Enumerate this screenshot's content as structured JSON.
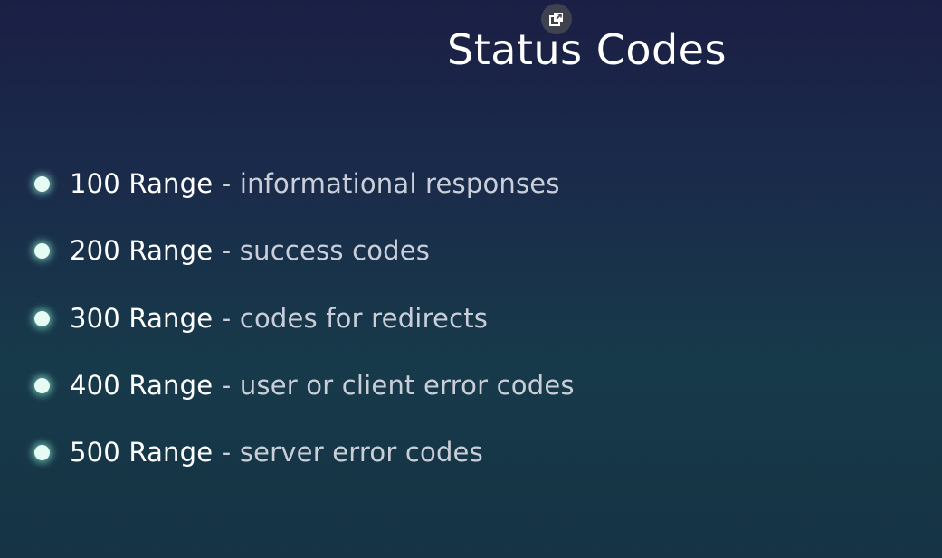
{
  "icons": {
    "popout": "popout-icon"
  },
  "title": "Status Codes",
  "items": [
    {
      "range": "100 Range",
      "separator": " - ",
      "description": "informational responses"
    },
    {
      "range": "200 Range",
      "separator": " - ",
      "description": "success codes"
    },
    {
      "range": "300 Range",
      "separator": " - ",
      "description": "codes for redirects"
    },
    {
      "range": "400 Range",
      "separator": " - ",
      "description": "user or client error codes"
    },
    {
      "range": "500 Range",
      "separator": " - ",
      "description": "server error codes"
    }
  ],
  "colors": {
    "background_top": "#1b1f45",
    "background_bottom": "#153344",
    "bullet": "#e6fbf4",
    "title": "#ffffff",
    "description": "#c9ced9"
  }
}
